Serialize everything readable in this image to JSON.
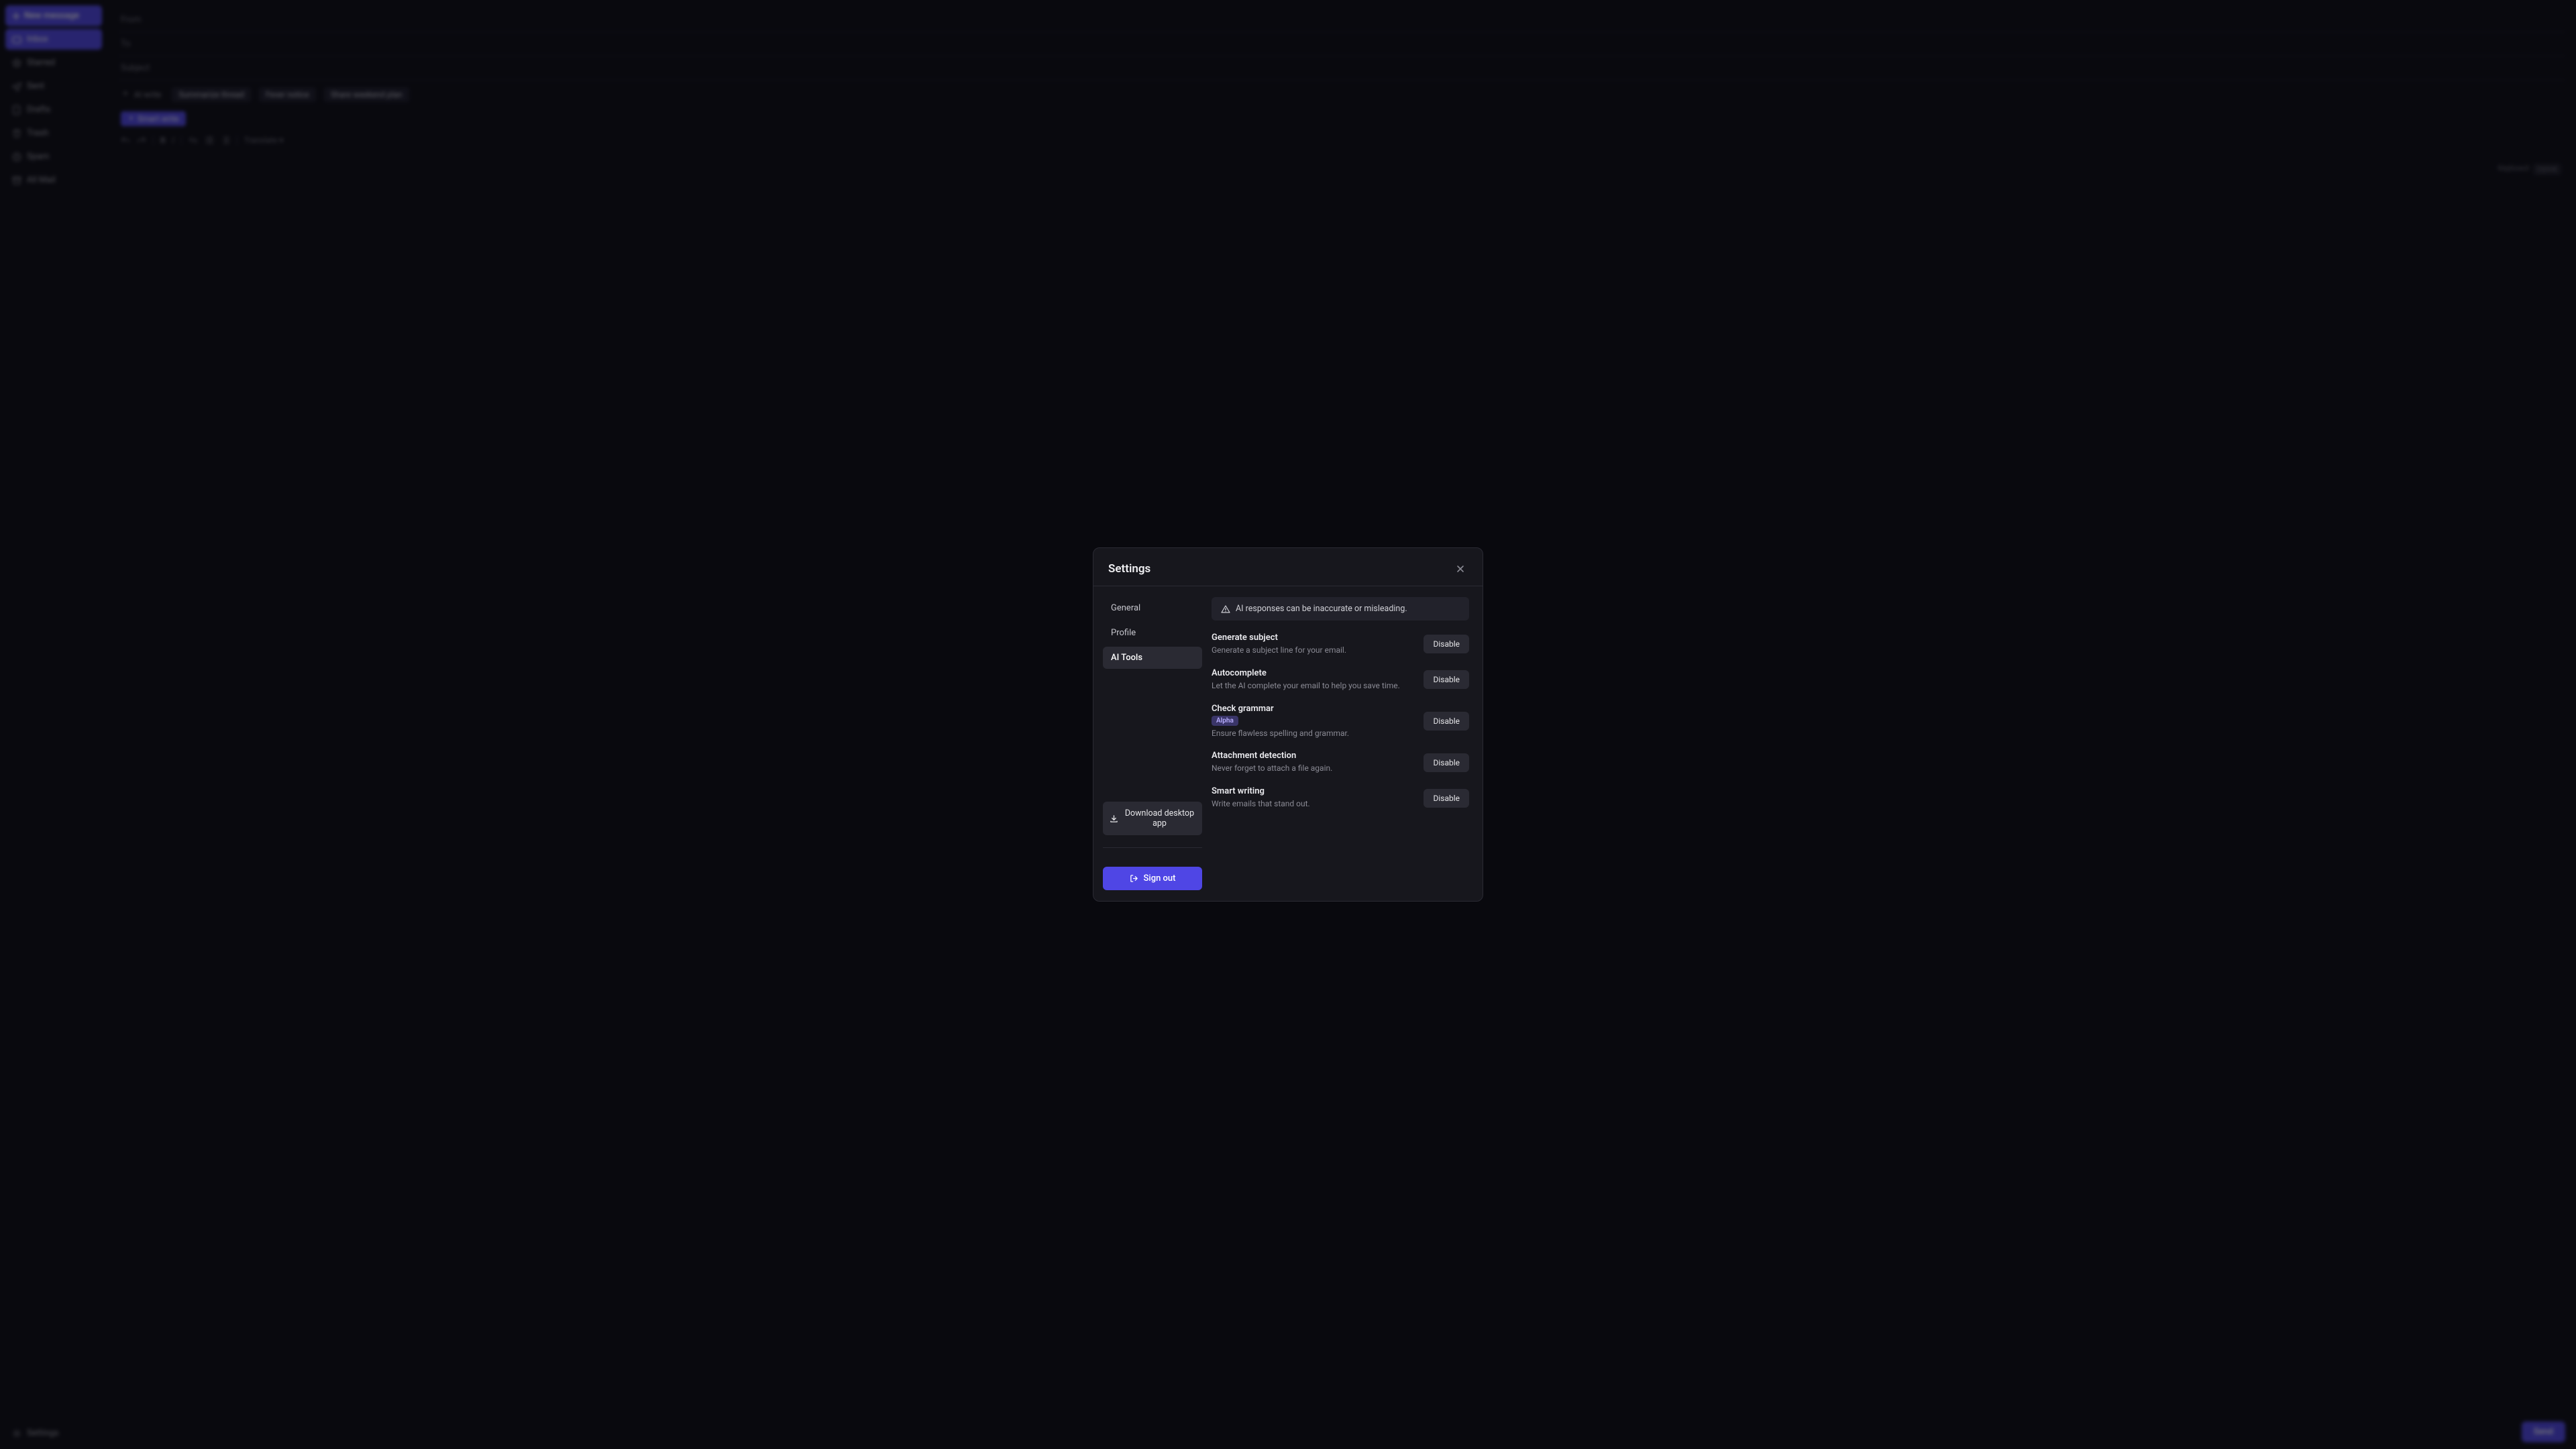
{
  "sidebar": {
    "new_message": "New message",
    "items": [
      {
        "id": "inbox",
        "label": "Inbox"
      },
      {
        "id": "starred",
        "label": "Starred"
      },
      {
        "id": "sent",
        "label": "Sent"
      },
      {
        "id": "drafts",
        "label": "Drafts"
      },
      {
        "id": "trash",
        "label": "Trash"
      },
      {
        "id": "spam",
        "label": "Spam"
      },
      {
        "id": "all-mail",
        "label": "All Mail"
      }
    ],
    "settings": "Settings"
  },
  "compose": {
    "from_prefix": "From",
    "to_prefix": "To",
    "subject_placeholder": "Subject",
    "ai_write_chip": "AI write",
    "chips": [
      "Summarize thread",
      "Fever notice",
      "Share weekend plan"
    ],
    "smart_write": "Smart write",
    "send": "Send",
    "translate": "Translate ▾",
    "keyboard_hint": "Keyboard",
    "shortcut_key": "Ctrl+K"
  },
  "modal": {
    "title": "Settings",
    "nav": {
      "general": "General",
      "profile": "Profile",
      "ai_tools": "AI Tools"
    },
    "download": "Download desktop app",
    "sign_out": "Sign out",
    "alert": "AI responses can be inaccurate or misleading.",
    "settings": [
      {
        "key": "generate_subject",
        "title": "Generate subject",
        "desc": "Generate a subject line for your email.",
        "action": "Disable"
      },
      {
        "key": "autocomplete",
        "title": "Autocomplete",
        "desc": "Let the AI complete your email to help you save time.",
        "action": "Disable"
      },
      {
        "key": "check_grammar",
        "title": "Check grammar",
        "badge": "Alpha",
        "desc": "Ensure flawless spelling and grammar.",
        "action": "Disable"
      },
      {
        "key": "attachment_detection",
        "title": "Attachment detection",
        "desc": "Never forget to attach a file again.",
        "action": "Disable"
      },
      {
        "key": "smart_writing",
        "title": "Smart writing",
        "desc": "Write emails that stand out.",
        "action": "Disable"
      }
    ]
  }
}
